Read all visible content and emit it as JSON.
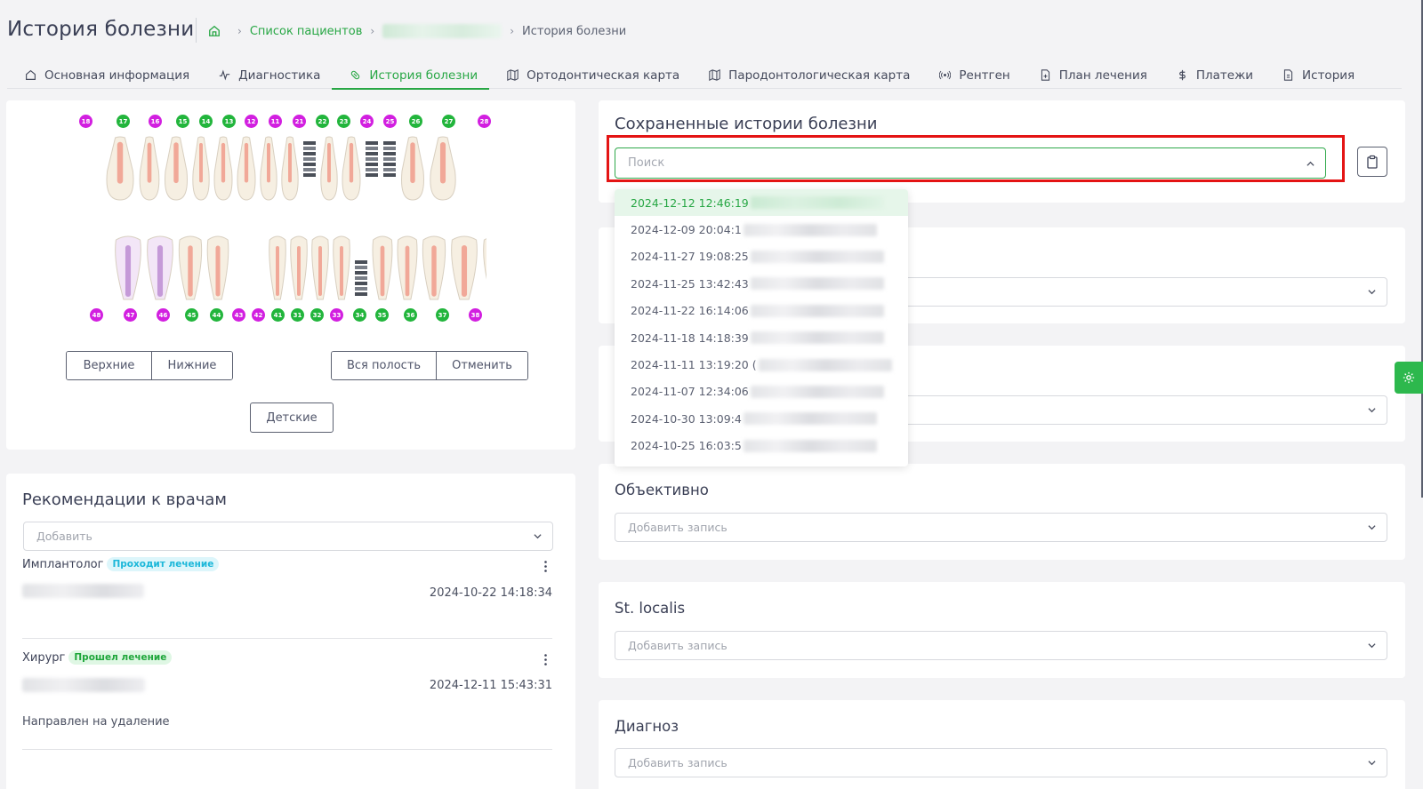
{
  "header": {
    "title": "История болезни",
    "breadcrumb": {
      "patients_link": "Список пациентов",
      "current": "История болезни"
    }
  },
  "tabs": [
    {
      "label": "Основная информация",
      "icon": "home-icon"
    },
    {
      "label": "Диагностика",
      "icon": "pulse-icon"
    },
    {
      "label": "История болезни",
      "icon": "pill-icon"
    },
    {
      "label": "Ортодонтическая карта",
      "icon": "map-icon"
    },
    {
      "label": "Пародонтологическая карта",
      "icon": "map-icon"
    },
    {
      "label": "Рентген",
      "icon": "broadcast-icon"
    },
    {
      "label": "План лечения",
      "icon": "file-plus-icon"
    },
    {
      "label": "Платежи",
      "icon": "dollar-icon"
    },
    {
      "label": "История",
      "icon": "file-icon"
    }
  ],
  "teeth": {
    "upper_numbers": [
      "18",
      "17",
      "16",
      "15",
      "14",
      "13",
      "12",
      "11",
      "21",
      "22",
      "23",
      "24",
      "25",
      "26",
      "27",
      "28"
    ],
    "upper_colors": [
      "m",
      "g",
      "m",
      "g",
      "g",
      "g",
      "m",
      "m",
      "m",
      "g",
      "g",
      "m",
      "m",
      "g",
      "g",
      "m"
    ],
    "lower_numbers": [
      "48",
      "47",
      "46",
      "45",
      "44",
      "43",
      "42",
      "41",
      "31",
      "32",
      "33",
      "34",
      "35",
      "36",
      "37",
      "38"
    ],
    "lower_colors": [
      "m",
      "m",
      "m",
      "g",
      "g",
      "m",
      "m",
      "g",
      "g",
      "g",
      "m",
      "g",
      "g",
      "g",
      "g",
      "m"
    ],
    "buttons": {
      "upper": "Верхние",
      "lower": "Нижние",
      "whole": "Вся полость",
      "cancel": "Отменить",
      "children": "Детские"
    }
  },
  "recommendations": {
    "title": "Рекомендации к врачам",
    "add_placeholder": "Добавить",
    "items": [
      {
        "role": "Имплантолог",
        "status": "Проходит лечение",
        "date": "2024-10-22 14:18:34",
        "note": ""
      },
      {
        "role": "Хирург",
        "status": "Прошел лечение",
        "date": "2024-12-11 15:43:31",
        "note": "Направлен на удаление"
      }
    ]
  },
  "saved_histories": {
    "title": "Сохраненные истории болезни",
    "search_placeholder": "Поиск",
    "options": [
      "2024-12-12 12:46:19",
      "2024-12-09 20:04:1",
      "2024-11-27 19:08:25",
      "2024-11-25 13:42:43",
      "2024-11-22 16:14:06",
      "2024-11-18 14:18:39",
      "2024-11-11 13:19:20 (",
      "2024-11-07 12:34:06",
      "2024-10-30 13:09:4",
      "2024-10-25 16:03:5"
    ]
  },
  "sections": [
    {
      "title": "Объективно",
      "placeholder": "Добавить запись"
    },
    {
      "title": "St. localis",
      "placeholder": "Добавить запись"
    },
    {
      "title": "Диагноз",
      "placeholder": "Добавить запись"
    }
  ],
  "colors": {
    "accent": "#28a745",
    "highlight": "#e41414",
    "upper_badge": "#d21fe0",
    "green_badge": "#22b53c"
  }
}
